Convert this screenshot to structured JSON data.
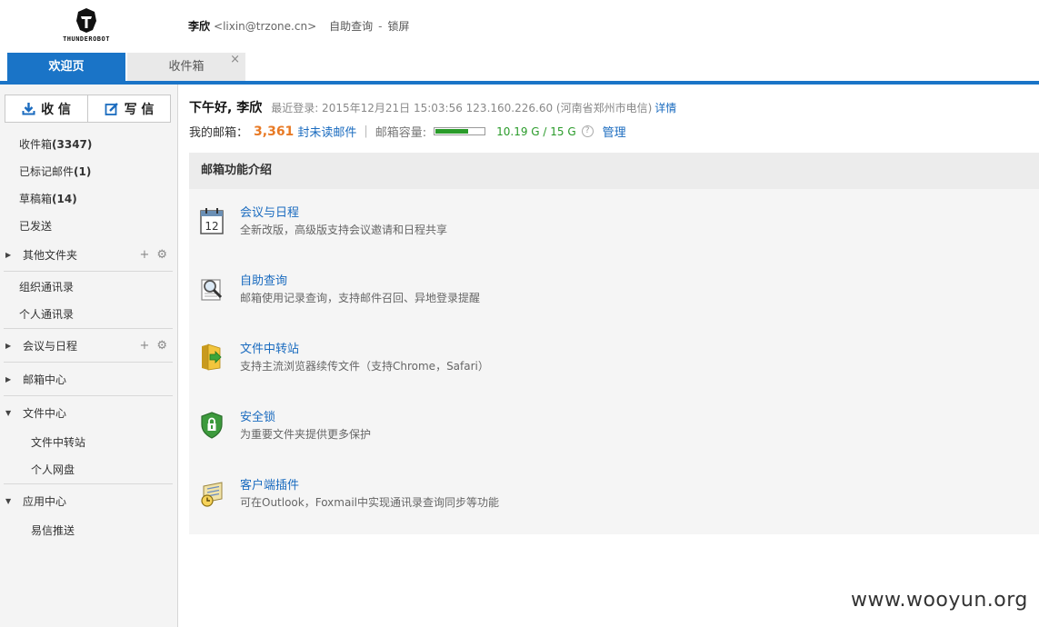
{
  "header": {
    "logo_text": "THUNDEROBOT",
    "user_name": "李欣",
    "user_email": "<lixin@trzone.cn>",
    "self_query_label": "自助查询",
    "separator": "-",
    "lock_label": "锁屏"
  },
  "tabs": [
    {
      "label": "欢迎页",
      "active": true
    },
    {
      "label": "收件箱",
      "close": "×"
    }
  ],
  "sidebar": {
    "receive_label": "收 信",
    "compose_label": "写 信",
    "folders": [
      {
        "label": "收件箱",
        "count": "(3347)"
      },
      {
        "label": "已标记邮件",
        "count": "(1)"
      },
      {
        "label": "草稿箱",
        "count": "(14)"
      },
      {
        "label": "已发送",
        "count": ""
      }
    ],
    "other_folders": "其他文件夹",
    "add_icon": "+",
    "gear_icon": "⚙",
    "contacts": [
      "组织通讯录",
      "个人通讯录"
    ],
    "meeting": "会议与日程",
    "mail_center": "邮箱中心",
    "file_center": "文件中心",
    "file_center_items": [
      "文件中转站",
      "个人网盘"
    ],
    "app_center": "应用中心",
    "app_center_items": [
      "易信推送"
    ]
  },
  "main": {
    "greeting": "下午好, 李欣",
    "last_login": "最近登录: 2015年12月21日 15:03:56 123.160.226.60 (河南省郑州市电信)",
    "detail_link": "详情",
    "mailbox_label": "我的邮箱：",
    "unread_count": "3,361",
    "unread_label": "封未读邮件",
    "divider": "|",
    "capacity_label": "邮箱容量:",
    "capacity_fraction": 0.68,
    "capacity_value": "10.19 G / 15 G",
    "help_glyph": "?",
    "manage_link": "管理",
    "panel_title": "邮箱功能介绍",
    "features": [
      {
        "title": "会议与日程",
        "desc": "全新改版，高级版支持会议邀请和日程共享",
        "icon": "calendar-icon"
      },
      {
        "title": "自助查询",
        "desc": "邮箱使用记录查询，支持邮件召回、异地登录提醒",
        "icon": "magnifier-icon"
      },
      {
        "title": "文件中转站",
        "desc": "支持主流浏览器续传文件（支持Chrome，Safari）",
        "icon": "folder-transfer-icon"
      },
      {
        "title": "安全锁",
        "desc": "为重要文件夹提供更多保护",
        "icon": "shield-lock-icon"
      },
      {
        "title": "客户端插件",
        "desc": "可在Outlook，Foxmail中实现通讯录查询同步等功能",
        "icon": "plugin-icon"
      }
    ],
    "calendar_day": "12"
  },
  "watermark": "www.wooyun.org"
}
